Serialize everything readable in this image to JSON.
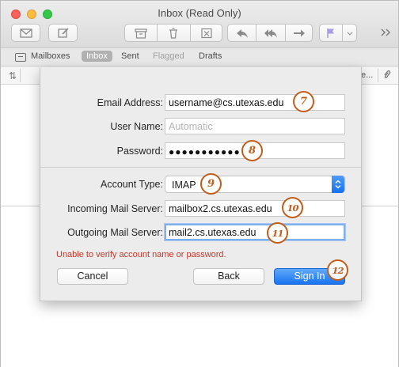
{
  "window": {
    "title": "Inbox (Read Only)"
  },
  "favorites": {
    "mailboxes": "Mailboxes",
    "inbox": "Inbox",
    "sent": "Sent",
    "flagged": "Flagged",
    "drafts": "Drafts"
  },
  "column_header": {
    "partial_label": "e..."
  },
  "sheet": {
    "email_label": "Email Address:",
    "email_value": "username@cs.utexas.edu",
    "username_label": "User Name:",
    "username_placeholder": "Automatic",
    "password_label": "Password:",
    "password_value": "●●●●●●●●●●●",
    "account_type_label": "Account Type:",
    "account_type_value": "IMAP",
    "incoming_label": "Incoming Mail Server:",
    "incoming_value": "mailbox2.cs.utexas.edu",
    "outgoing_label": "Outgoing Mail Server:",
    "outgoing_value": "mail2.cs.utexas.edu",
    "error_message": "Unable to verify account name or password.",
    "cancel_label": "Cancel",
    "back_label": "Back",
    "signin_label": "Sign In"
  },
  "annotations": {
    "step_email": "7",
    "step_password": "8",
    "step_account_type": "9",
    "step_incoming": "10",
    "step_outgoing": "11",
    "step_signin": "12",
    "badge_color": "#c15d1b"
  },
  "colors": {
    "accent": "#1a73ee",
    "error": "#c03a2b"
  },
  "icons": [
    "envelope-icon",
    "compose-icon",
    "archive-icon",
    "trash-icon",
    "junk-icon",
    "reply-icon",
    "reply-all-icon",
    "forward-icon",
    "flag-icon",
    "chevron-down-icon",
    "sidebar-toggle-icon",
    "mailbox-icon",
    "attachment-icon"
  ]
}
